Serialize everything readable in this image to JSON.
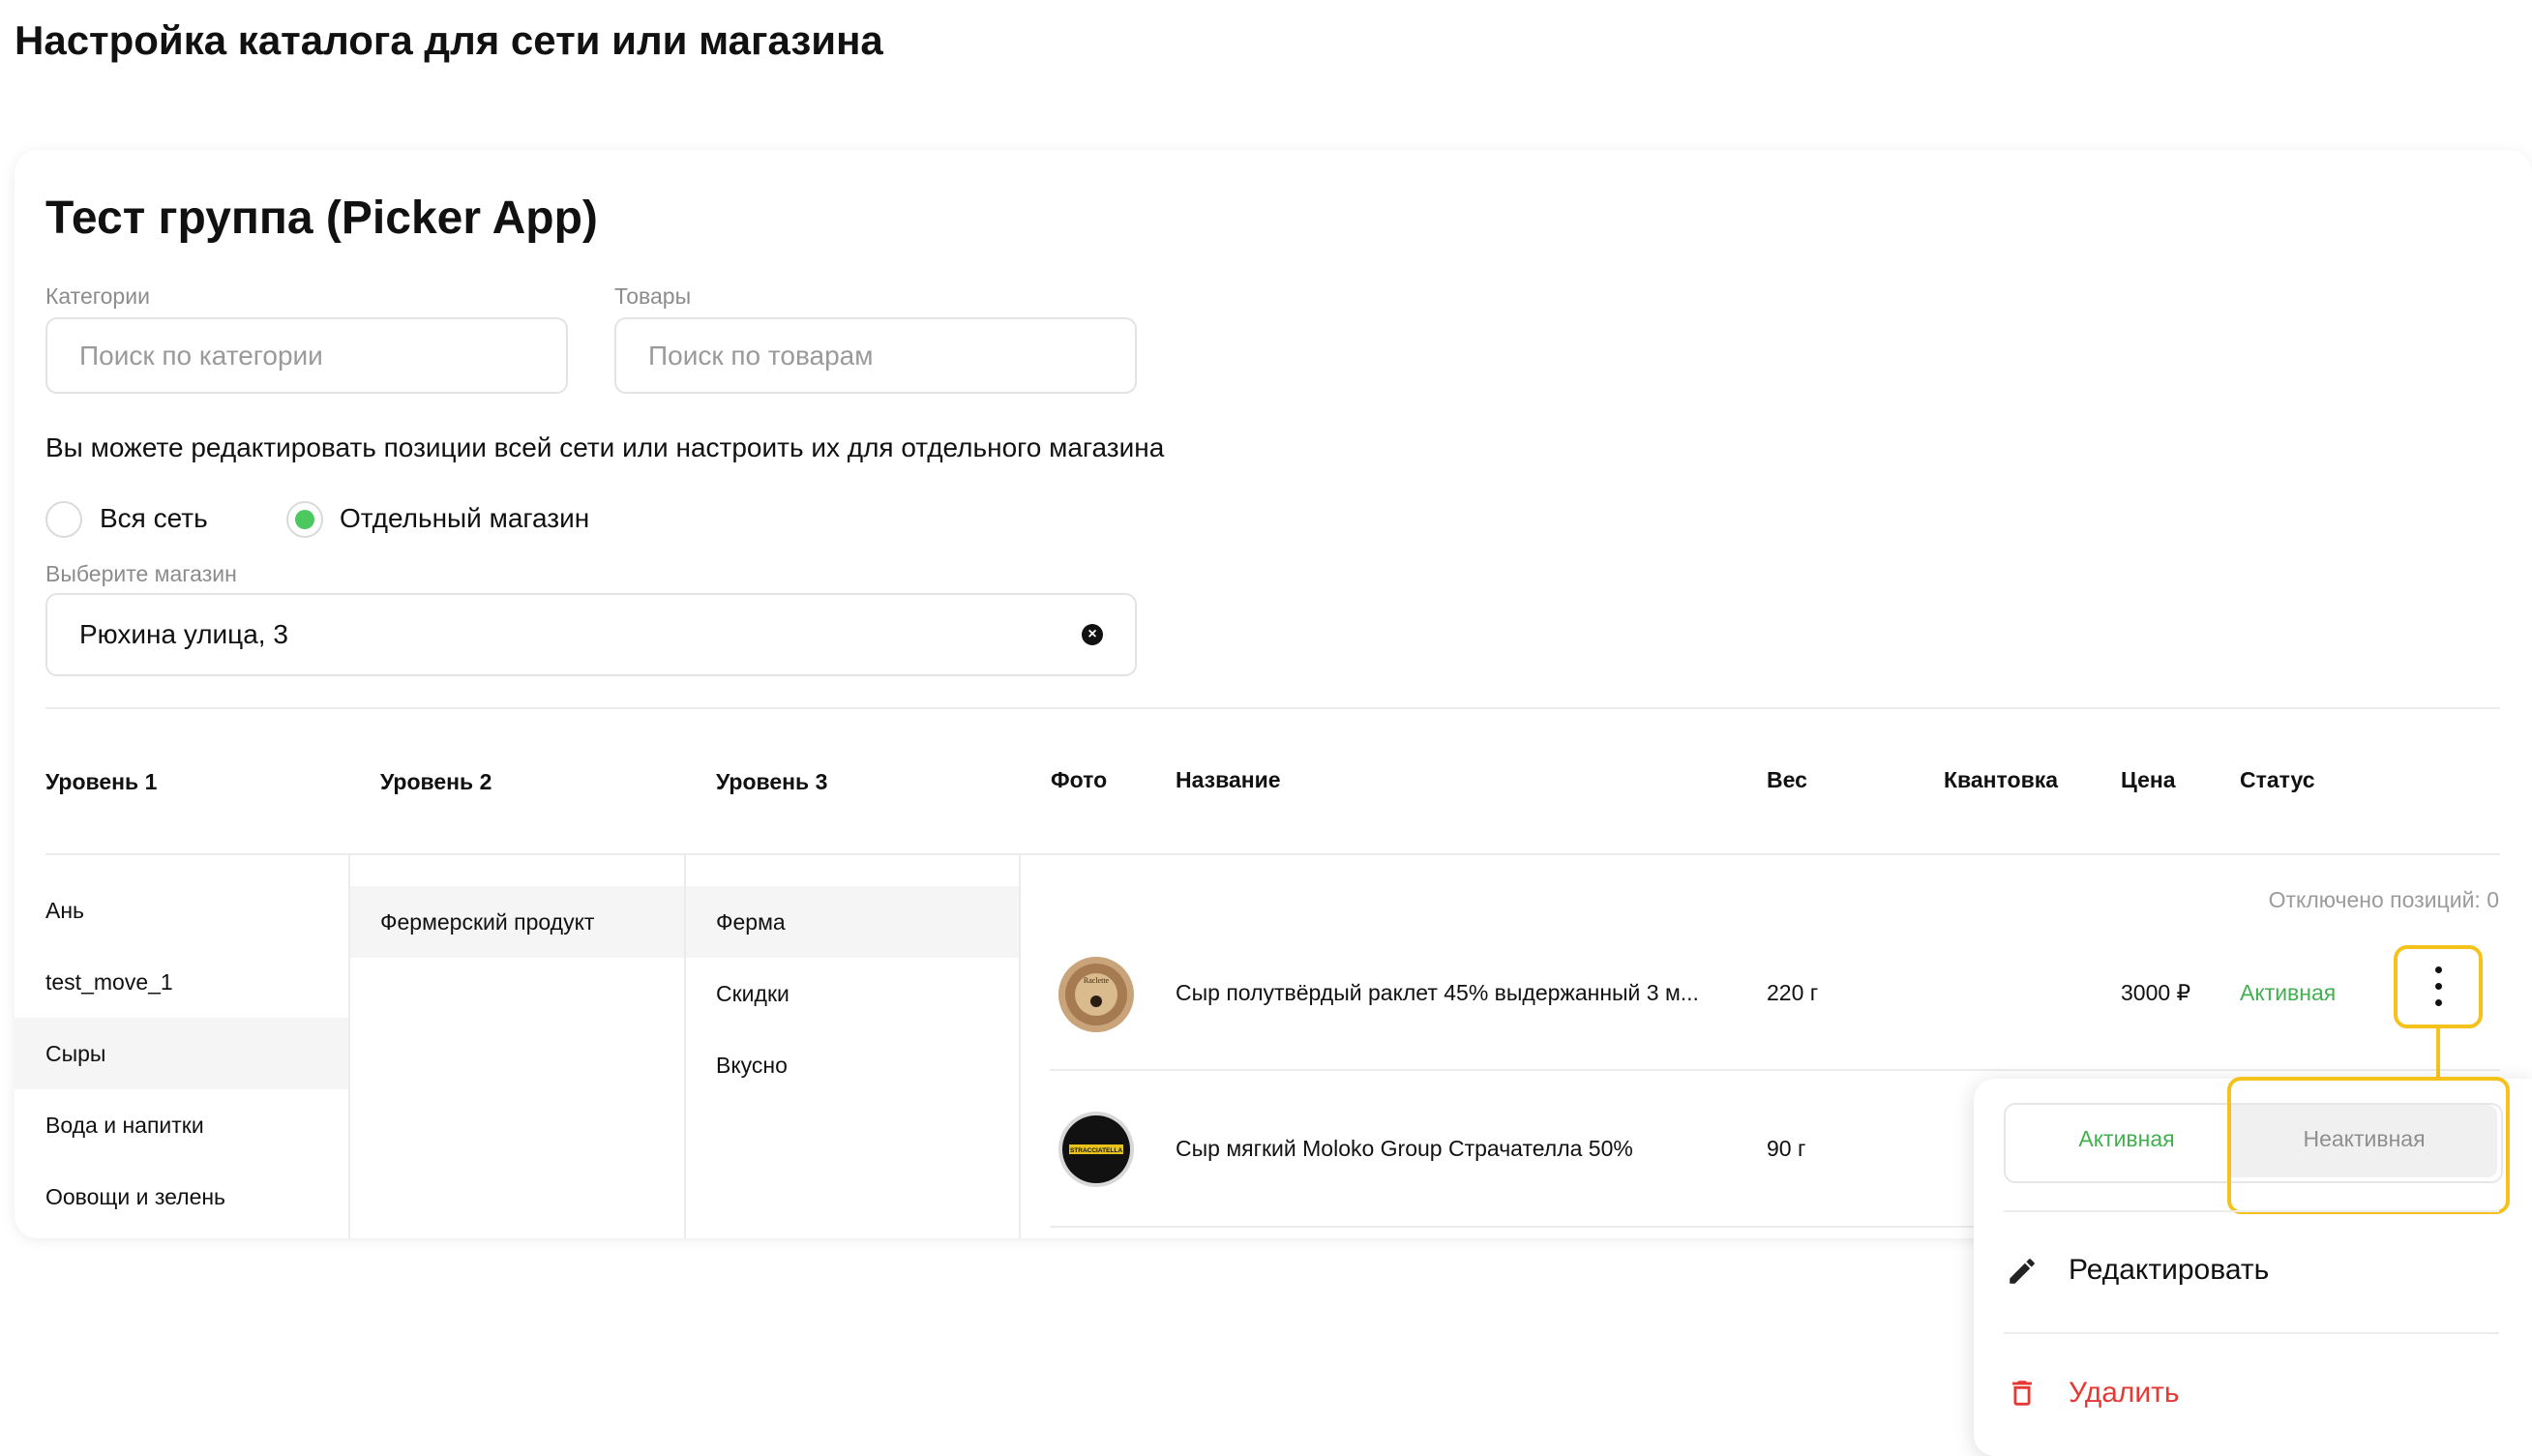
{
  "page": {
    "title": "Настройка каталога для сети или магазина"
  },
  "group": {
    "title": "Тест группа (Picker App)"
  },
  "filters": {
    "categories_label": "Категории",
    "categories_placeholder": "Поиск по категории",
    "products_label": "Товары",
    "products_placeholder": "Поиск по товарам"
  },
  "scope": {
    "info": "Вы можете редактировать позиции всей сети или настроить их для отдельного магазина",
    "options": [
      "Вся сеть",
      "Отдельный магазин"
    ],
    "selected": "Отдельный магазин",
    "store_label": "Выберите магазин",
    "store_value": "Рюхина улица, 3"
  },
  "columns": {
    "level1": "Уровень 1",
    "level2": "Уровень 2",
    "level3": "Уровень 3",
    "photo": "Фото",
    "name": "Название",
    "weight": "Вес",
    "quantization": "Квантовка",
    "price": "Цена",
    "status": "Статус"
  },
  "level1_items": [
    "Ань",
    "test_move_1",
    "Сыры",
    "Вода и напитки",
    "Оовощи и зелень"
  ],
  "level1_selected": "Сыры",
  "level2_items": [
    "Фермерский продукт"
  ],
  "level3_items": [
    "Ферма",
    "Скидки",
    "Вкусно"
  ],
  "disabled_count": "Отключено позиций: 0",
  "products": [
    {
      "name": "Сыр полутвёрдый раклет 45% выдержанный 3 м...",
      "weight": "220 г",
      "price": "3000 ₽",
      "status": "Активная",
      "photo_label": "Raclette"
    },
    {
      "name": "Сыр мягкий Moloko Group Страчателла 50%",
      "weight": "90 г",
      "price": "",
      "status": "",
      "photo_label": "STRACCIATELLA"
    }
  ],
  "popup": {
    "active_label": "Активная",
    "inactive_label": "Неактивная",
    "edit_label": "Редактировать",
    "delete_label": "Удалить"
  },
  "colors": {
    "accent_green": "#41b14f",
    "highlight_yellow": "#f5c21b",
    "danger_red": "#e53935"
  }
}
